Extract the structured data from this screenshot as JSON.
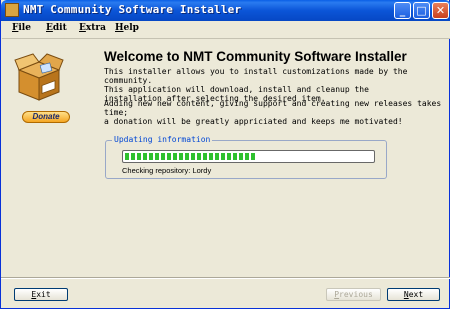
{
  "window": {
    "title": "NMT Community Software Installer"
  },
  "title_buttons": {
    "minimize": "_",
    "maximize": "□",
    "close": "✕"
  },
  "menu": {
    "items": [
      {
        "underline": "F",
        "rest": "ile"
      },
      {
        "underline": "E",
        "rest": "dit"
      },
      {
        "underline": "E",
        "rest": "xtra"
      },
      {
        "underline": "H",
        "rest": "elp"
      }
    ]
  },
  "main": {
    "heading": "Welcome to NMT Community Software Installer",
    "paragraph1": "This installer allows you to install customizations made by the community.\nThis application will download, install and cleanup the\ninstallation after selecting the desired item.",
    "paragraph2": "Adding new new content, giving support and creating new releases takes time;\na donation will be greatly appriciated and keeps me motivated!",
    "donate_label": "Donate"
  },
  "update": {
    "legend": "Updating information",
    "progress": 0.53,
    "status": "Checking repository: Lordy"
  },
  "footer": {
    "exit": {
      "underline": "E",
      "rest": "xit"
    },
    "previous": {
      "underline": "P",
      "rest": "revious"
    },
    "next": {
      "underline": "N",
      "rest": "ext"
    }
  },
  "colors": {
    "titlebar": "#0b55d8",
    "progress": "#2ec02e",
    "legend": "#0046d5"
  },
  "icons": {
    "app": "box-icon",
    "main": "package-icon"
  }
}
